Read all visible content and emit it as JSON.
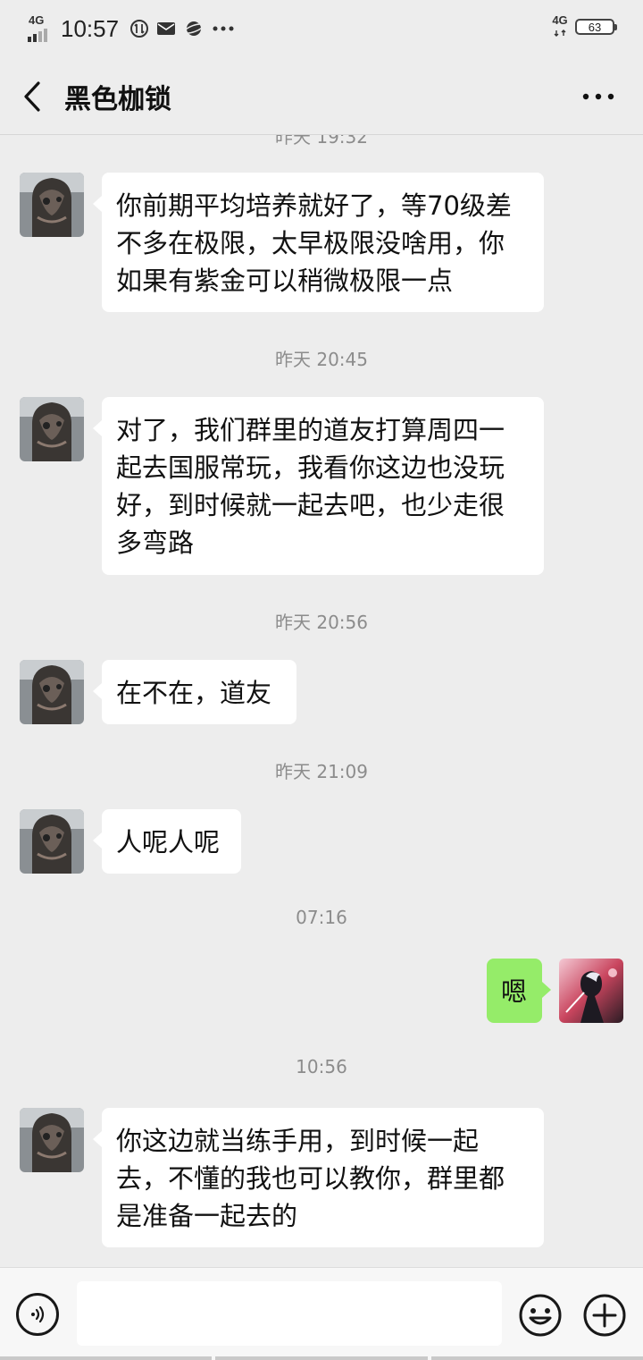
{
  "status_bar": {
    "network_left": "4G",
    "time": "10:57",
    "network_right": "4G",
    "battery": "63"
  },
  "nav": {
    "title": "黑色枷锁"
  },
  "chat": {
    "partial_timestamp": "昨天 19:32",
    "timestamps": [
      "昨天 20:45",
      "昨天 20:56",
      "昨天 21:09",
      "07:16",
      "10:56"
    ],
    "messages": [
      {
        "side": "left",
        "text": "你前期平均培养就好了，等70级差不多在极限，太早极限没啥用，你如果有紫金可以稍微极限一点"
      },
      {
        "side": "left",
        "text": "对了，我们群里的道友打算周四一起去国服常玩，我看你这边也没玩好，到时候就一起去吧，也少走很多弯路"
      },
      {
        "side": "left",
        "text": "在不在，道友"
      },
      {
        "side": "left",
        "text": "人呢人呢"
      },
      {
        "side": "right",
        "text": "嗯"
      },
      {
        "side": "left",
        "text": "你这边就当练手用，到时候一起去，不懂的我也可以教你，群里都是准备一起去的"
      }
    ]
  },
  "input": {
    "value": ""
  },
  "colors": {
    "background": "#ededed",
    "incoming_bubble": "#ffffff",
    "outgoing_bubble": "#95ec69"
  },
  "icons": {
    "back": "chevron-left-icon",
    "more": "more-dots-icon",
    "voice": "voice-icon",
    "emoji": "emoji-icon",
    "plus": "plus-icon"
  }
}
